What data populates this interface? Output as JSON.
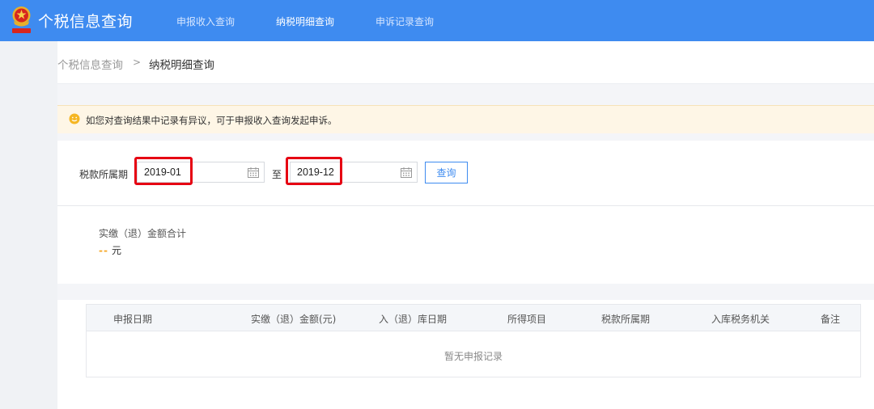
{
  "header": {
    "app_title": "个税信息查询",
    "nav": [
      {
        "label": "申报收入查询",
        "active": false
      },
      {
        "label": "纳税明细查询",
        "active": true
      },
      {
        "label": "申诉记录查询",
        "active": false
      }
    ]
  },
  "breadcrumb": {
    "parent": "个税信息查询",
    "separator": ">",
    "current": "纳税明细查询"
  },
  "notice": {
    "icon": "smile-icon",
    "text": "如您对查询结果中记录有异议，可于申报收入查询发起申诉。"
  },
  "query": {
    "period_label": "税款所属期",
    "start_date": "2019-01",
    "to_label": "至",
    "end_date": "2019-12",
    "search_label": "查询"
  },
  "summary": {
    "label": "实缴（退）金额合计",
    "value": "--",
    "unit": "元"
  },
  "table": {
    "columns": [
      "申报日期",
      "实缴（退）金额(元)",
      "入（退）库日期",
      "所得项目",
      "税款所属期",
      "入库税务机关",
      "备注"
    ],
    "empty_text": "暂无申报记录"
  },
  "colors": {
    "brand_blue": "#3e8bf0",
    "highlight_red": "#e60012",
    "notice_bg": "#fef6e6",
    "dash_orange": "#f5a623"
  }
}
